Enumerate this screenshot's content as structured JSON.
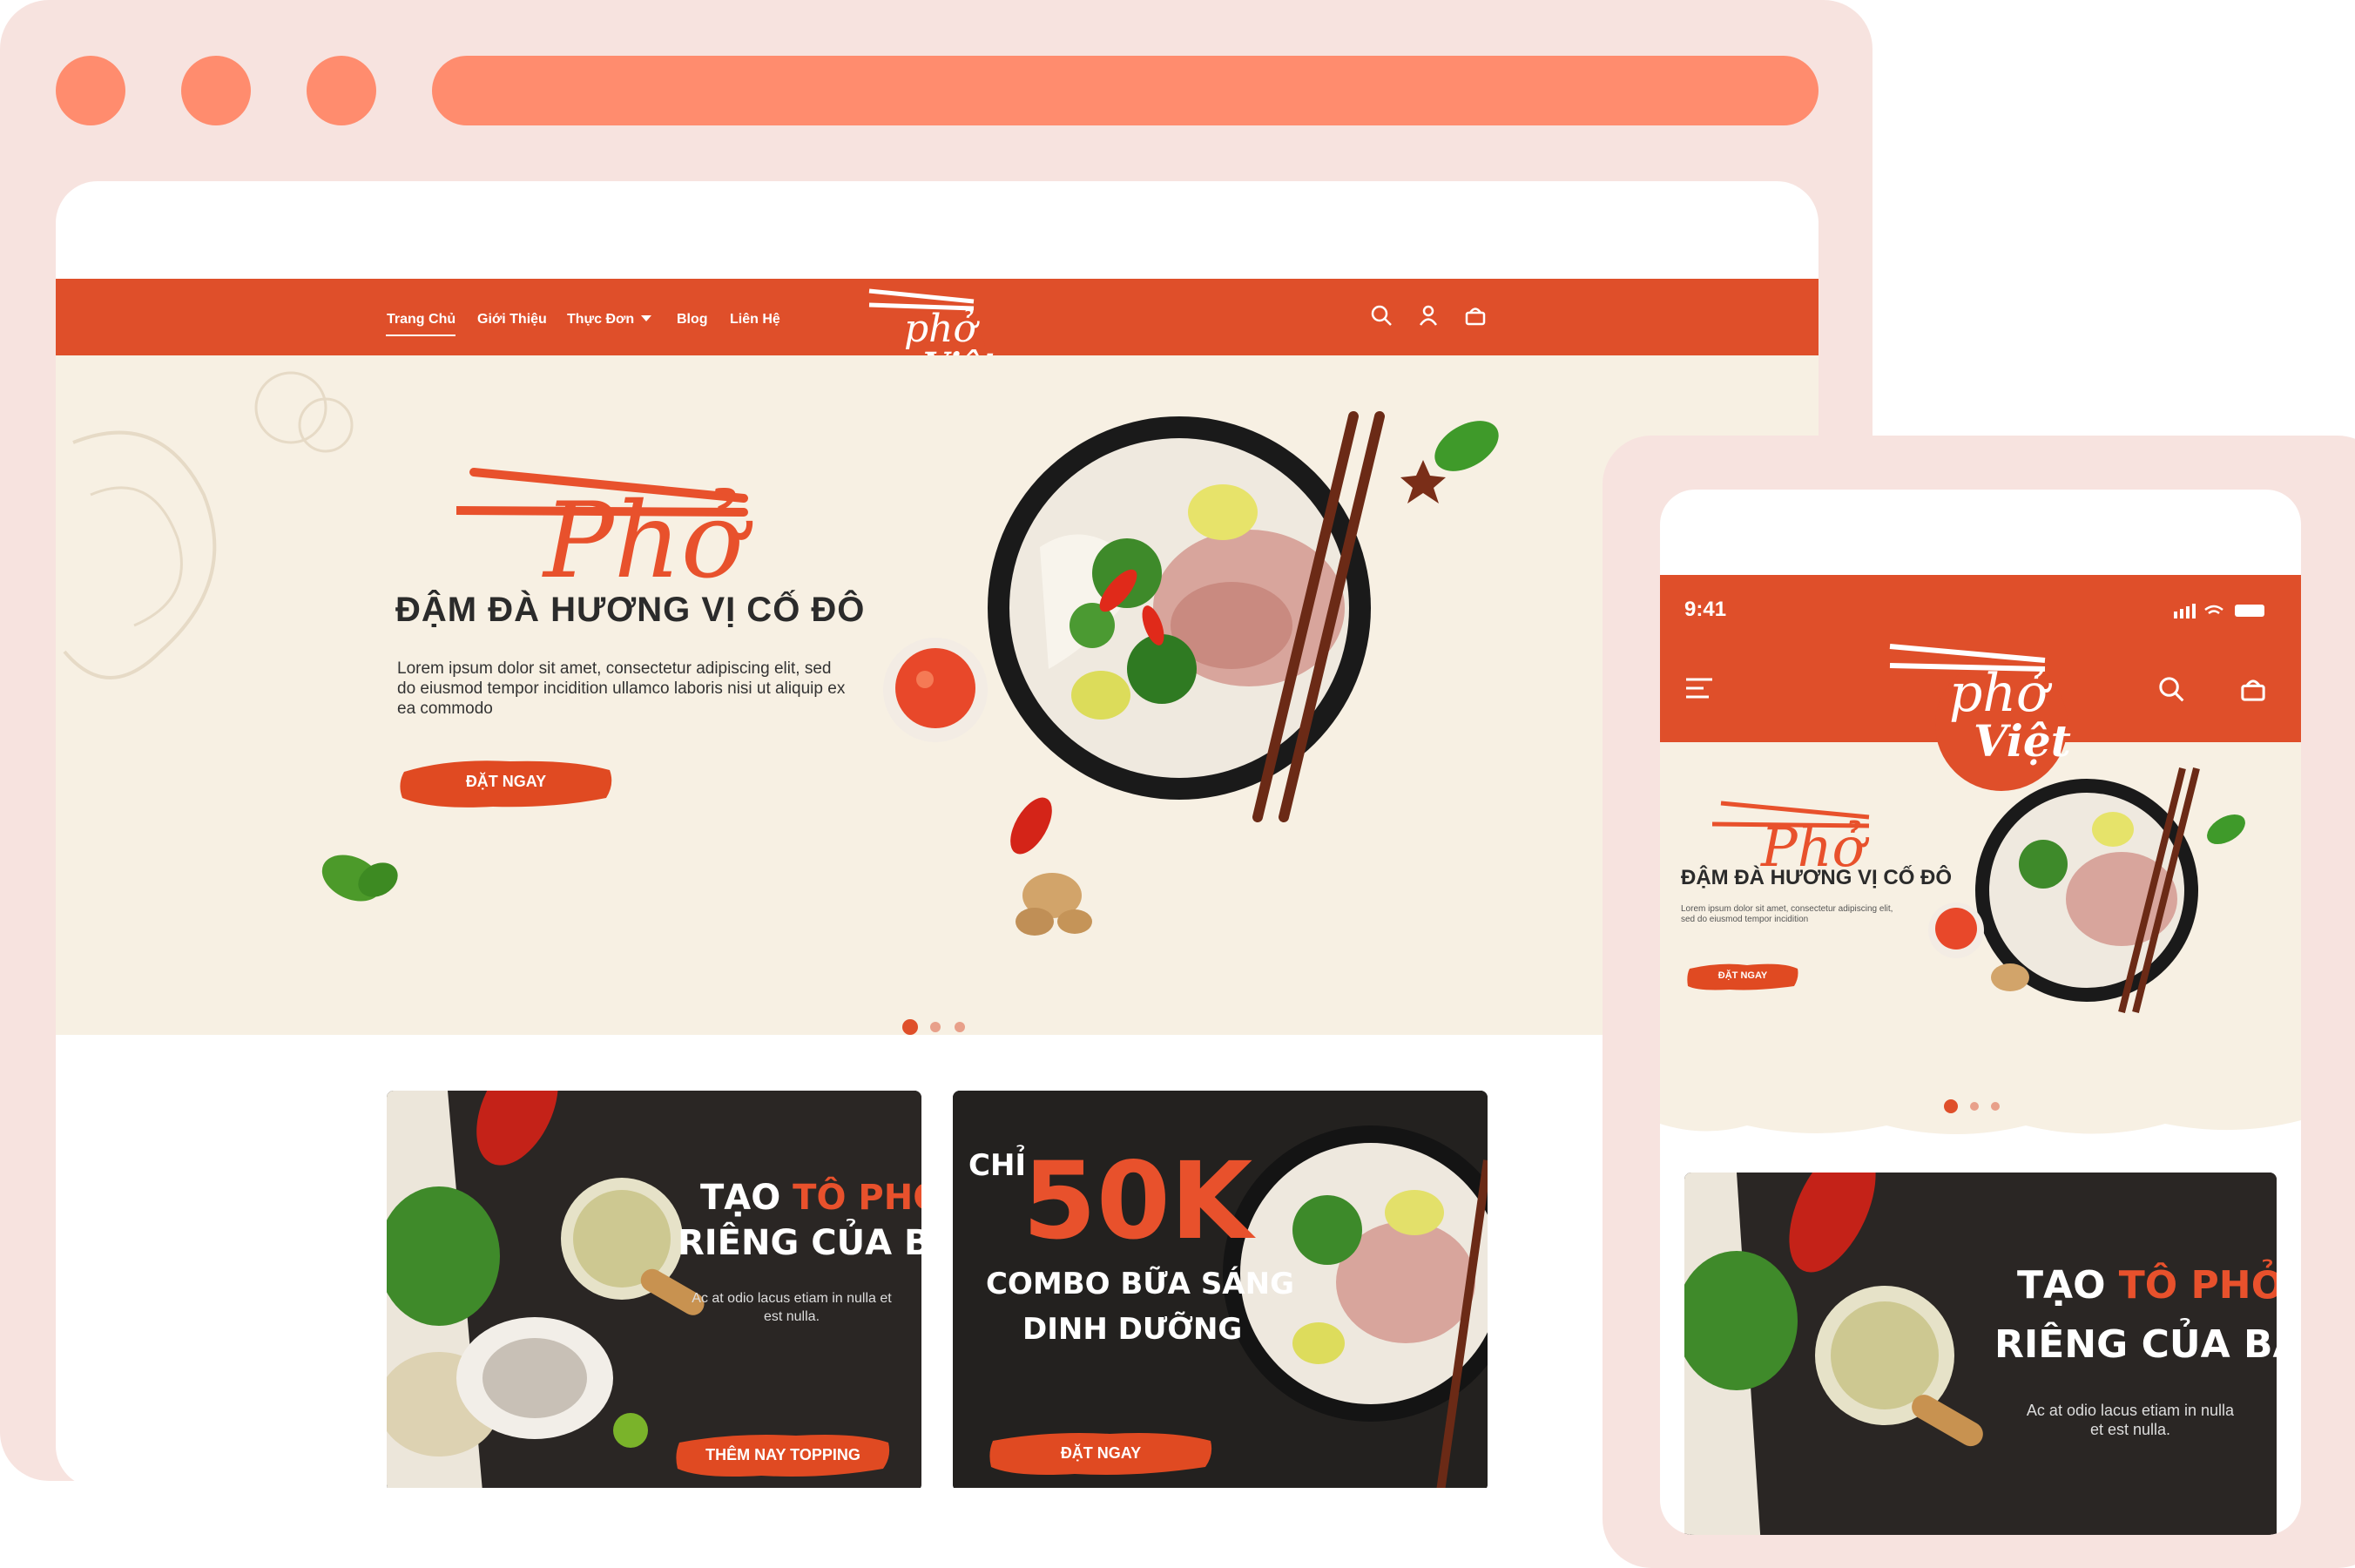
{
  "desktop": {
    "nav": {
      "items": [
        {
          "label": "Trang Chủ"
        },
        {
          "label": "Giới Thiệu"
        },
        {
          "label": "Thực Đơn"
        },
        {
          "label": "Blog"
        },
        {
          "label": "Liên Hệ"
        }
      ],
      "icons": [
        "search-icon",
        "user-icon",
        "basket-icon"
      ],
      "logo_text": "Phở Việt"
    },
    "hero": {
      "script_word": "Phở",
      "title": "ĐẬM ĐÀ HƯƠNG VỊ CỐ ĐÔ",
      "description": "Lorem ipsum dolor sit amet, consectetur adipiscing elit, sed do eiusmod tempor incidition ullamco laboris nisi ut aliquip ex ea commodo",
      "cta_label": "ĐẶT NGAY",
      "slides": {
        "count": 3,
        "active": 1
      }
    },
    "cards": [
      {
        "title_line1_plain": "TẠO ",
        "title_line1_accent": "TÔ PHỞ",
        "title_line2": "RIÊNG CỦA BẠN",
        "text": "Ac at odio lacus etiam in nulla et est nulla.",
        "cta_label": "THÊM NAY TOPPING"
      },
      {
        "prefix": "CHỈ",
        "price": "50K",
        "line1": "COMBO BỮA SÁNG",
        "line2": "DINH DƯỠNG",
        "cta_label": "ĐẶT NGAY"
      }
    ]
  },
  "mobile": {
    "status_time": "9:41",
    "hero": {
      "script_word": "Phở",
      "title": "ĐẬM ĐÀ HƯƠNG VỊ CỐ ĐÔ",
      "description": "Lorem ipsum dolor sit amet, consectetur adipiscing elit, sed do eiusmod tempor incidition",
      "cta_label": "ĐẶT NGAY",
      "slides": {
        "count": 3,
        "active": 1
      }
    },
    "card": {
      "title_line1_plain": "TẠO ",
      "title_line1_accent": "TÔ PHỞ",
      "title_line2": "RIÊNG CỦA BẠN",
      "text": "Ac at odio lacus etiam in nulla et est nulla."
    }
  },
  "colors": {
    "brand_red": "#df4f2a",
    "frame_pink": "#f7e3df",
    "frame_dots": "#ff8c6e",
    "hero_cream": "#f7f0e3",
    "card_dark": "#222222"
  }
}
